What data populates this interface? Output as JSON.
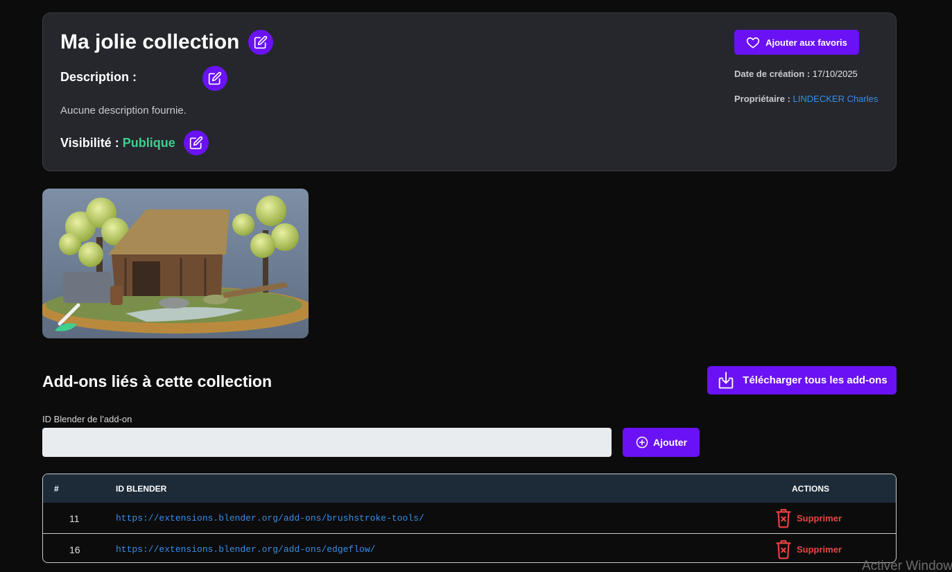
{
  "collection": {
    "title": "Ma jolie collection",
    "description_label": "Description :",
    "description_text": "Aucune description fournie.",
    "visibility_label": "Visibilité :",
    "visibility_value": "Publique",
    "favorite_label": "Ajouter aux favoris",
    "creation_label": "Date de création :",
    "creation_value": "17/10/2025",
    "owner_label": "Propriétaire :",
    "owner_value": "LINDECKER Charles"
  },
  "addons": {
    "section_title": "Add-ons liés à cette collection",
    "download_all_label": "Télécharger tous les add-ons",
    "input_label": "ID Blender de l’add-on",
    "input_value": "",
    "input_placeholder": "",
    "add_label": "Ajouter"
  },
  "table": {
    "headers": {
      "num": "#",
      "id": "ID BLENDER",
      "actions": "ACTIONS"
    },
    "rows": [
      {
        "num": "11",
        "id": "https://extensions.blender.org/add-ons/brushstroke-tools/",
        "action": "Supprimer"
      },
      {
        "num": "16",
        "id": "https://extensions.blender.org/add-ons/edgeflow/",
        "action": "Supprimer"
      }
    ]
  },
  "os": {
    "watermark": "Activer Windows"
  },
  "colors": {
    "accent": "#6a12f5",
    "public_green": "#3fcf8e",
    "link_blue": "#3a8ee6",
    "danger_red": "#e94545",
    "card_bg": "#25272d",
    "table_header_bg": "#1d2b39"
  },
  "icons": {
    "edit": "pencil-square-icon",
    "favorite": "heart-icon",
    "download": "download-tray-icon",
    "add": "plus-circle-icon",
    "delete": "trash-icon"
  }
}
